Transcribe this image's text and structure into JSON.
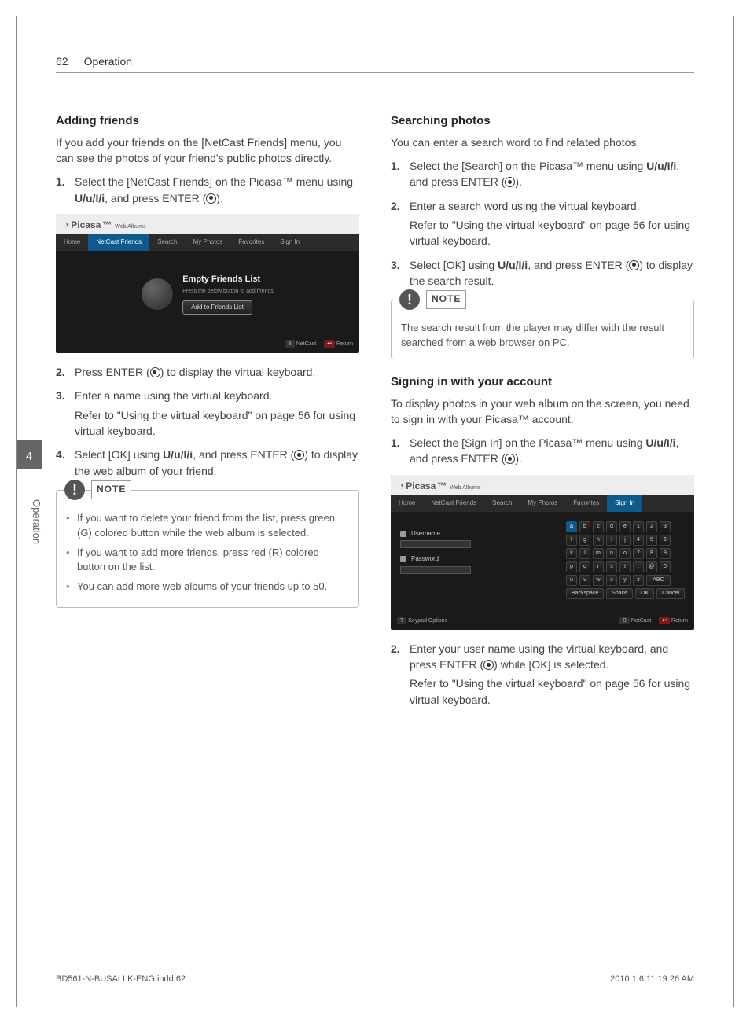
{
  "header": {
    "page_number": "62",
    "section": "Operation"
  },
  "side": {
    "chapter_number": "4",
    "chapter_label": "Operation"
  },
  "left": {
    "h_adding": "Adding friends",
    "adding_intro": "If you add your friends on the [NetCast Friends] menu, you can see the photos of your friend's public photos directly.",
    "step1_a": "Select the [NetCast Friends] on the Picasa™ menu using ",
    "step1_nav": "U/u/I/i",
    "step1_b": ", and press ENTER (",
    "step1_c": ").",
    "step2_a": "Press ENTER (",
    "step2_b": ") to display the virtual keyboard.",
    "step3": "Enter a name using the virtual keyboard.",
    "step3_sub": "Refer to \"Using the virtual keyboard\" on page 56 for using virtual keyboard.",
    "step4_a": "Select [OK] using ",
    "step4_b": ", and press ENTER (",
    "step4_c": ") to display the web album of your friend.",
    "note_label": "NOTE",
    "note1": "If you want to delete your friend from the list, press green (G) colored button while the web album is selected.",
    "note2": "If you want to add more friends, press red (R) colored button on the list.",
    "note3": "You can add more web albums of your friends up to 50.",
    "mock": {
      "brand": "Picasa",
      "brand_sub": "Web Albums",
      "tabs": [
        "Home",
        "NetCast Friends",
        "Search",
        "My Photos",
        "Favorites",
        "Sign In"
      ],
      "title": "Empty Friends List",
      "subtitle": "Press the below button to add friends",
      "button": "Add to Friends List",
      "foot_b": "NetCast",
      "foot_r": "Return"
    }
  },
  "right": {
    "h_search": "Searching photos",
    "search_intro": "You can enter a search word to find related photos.",
    "s1_a": "Select the [Search] on the Picasa™ menu using ",
    "s1_b": ", and press ENTER (",
    "s1_c": ").",
    "s2": "Enter a search word using the virtual keyboard.",
    "s2_sub": "Refer to \"Using the virtual keyboard\" on page 56 for using virtual keyboard.",
    "s3_a": "Select [OK] using ",
    "s3_b": ", and press ENTER (",
    "s3_c": ") to display the search result.",
    "note_label": "NOTE",
    "note_text": "The search result from the player may differ with the result searched from a web browser on PC.",
    "h_signin": "Signing in with your account",
    "signin_intro": "To display photos in your web album on the screen, you need to sign in with your Picasa™ account.",
    "si1_a": "Select the [Sign In] on the Picasa™ menu using ",
    "si1_b": ", and press ENTER (",
    "si1_c": ").",
    "si2_a": "Enter your user name using the virtual keyboard, and press ENTER (",
    "si2_b": ") while [OK] is selected.",
    "si2_sub": "Refer to \"Using the virtual keyboard\" on page 56 for using virtual keyboard.",
    "mock": {
      "brand": "Picasa",
      "brand_sub": "Web Albums",
      "tabs": [
        "Home",
        "NetCast Friends",
        "Search",
        "My Photos",
        "Favorites",
        "Sign In"
      ],
      "username": "Username",
      "password": "Password",
      "keys_r1": [
        "a",
        "b",
        "c",
        "d",
        "e",
        "1",
        "2",
        "3"
      ],
      "keys_r2": [
        "f",
        "g",
        "h",
        "i",
        "j",
        "4",
        "5",
        "6"
      ],
      "keys_r3": [
        "k",
        "l",
        "m",
        "n",
        "o",
        "7",
        "8",
        "9"
      ],
      "keys_r4": [
        "p",
        "q",
        "r",
        "s",
        "t",
        ".",
        "@",
        "0"
      ],
      "keys_r5": [
        "u",
        "v",
        "w",
        "x",
        "y",
        "z",
        "ABC"
      ],
      "bottom": [
        "Backspace",
        "Space",
        "OK",
        "Cancel"
      ],
      "foot_l": "Keypad Options",
      "foot_b": "NetCast",
      "foot_r": "Return"
    }
  },
  "nav_symbols": "U/u/I/i",
  "footer": {
    "left": "BD561-N-BUSALLK-ENG.indd   62",
    "right": "2010.1.6   11:19:26 AM"
  }
}
